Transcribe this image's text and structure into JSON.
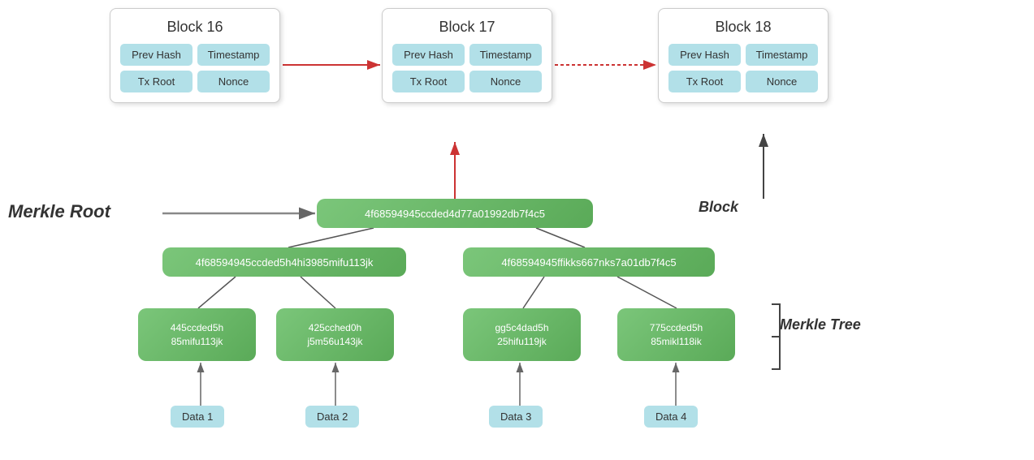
{
  "blocks": [
    {
      "id": "block-16",
      "title": "Block 16",
      "fields": [
        "Prev Hash",
        "Timestamp",
        "Tx Root",
        "Nonce"
      ]
    },
    {
      "id": "block-17",
      "title": "Block 17",
      "fields": [
        "Prev Hash",
        "Timestamp",
        "Tx Root",
        "Nonce"
      ]
    },
    {
      "id": "block-18",
      "title": "Block 18",
      "fields": [
        "Prev Hash",
        "Timestamp",
        "Tx Root",
        "Nonce"
      ]
    }
  ],
  "hashes": {
    "merkle_root": "4f68594945ccded4d77a01992db7f4c5",
    "left_mid": "4f68594945ccded5h4hi3985mifu113jk",
    "right_mid": "4f68594945ffikks667nks7a01db7f4c5",
    "leaf1_line1": "445ccded5h",
    "leaf1_line2": "85mifu113jk",
    "leaf2_line1": "425cched0h",
    "leaf2_line2": "j5m56u143jk",
    "leaf3_line1": "gg5c4dad5h",
    "leaf3_line2": "25hifu119jk",
    "leaf4_line1": "775ccded5h",
    "leaf4_line2": "85mikl118ik"
  },
  "data_labels": [
    "Data 1",
    "Data 2",
    "Data 3",
    "Data 4"
  ],
  "labels": {
    "merkle_root": "Merkle Root",
    "block": "Block",
    "merkle_tree": "Merkle Tree"
  }
}
